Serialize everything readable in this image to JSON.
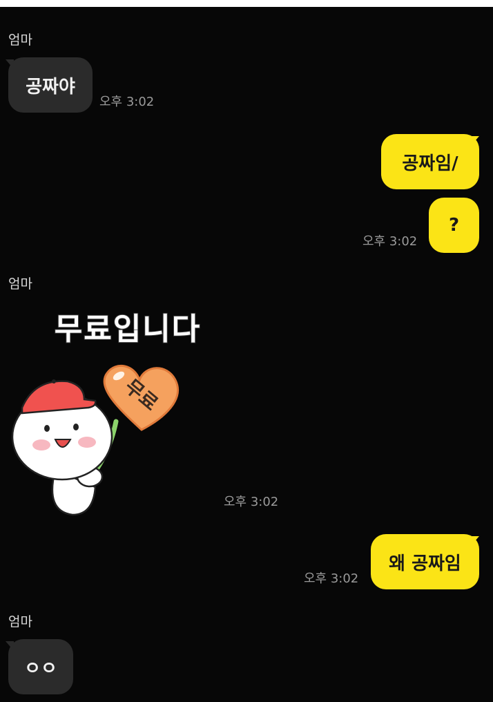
{
  "messages": [
    {
      "sender": "엄마",
      "text": "공짜야",
      "time": "오후 3:02"
    },
    {
      "text": "공짜임/"
    },
    {
      "text": "?",
      "time": "오후 3:02"
    },
    {
      "sender": "엄마",
      "sticker_text": "무료입니다",
      "sticker_heart_text": "무료",
      "time": "오후 3:02"
    },
    {
      "text": "왜 공짜임",
      "time": "오후 3:02"
    },
    {
      "sender": "엄마",
      "text": "ㅇㅇ"
    }
  ],
  "colors": {
    "background": "#070707",
    "incoming_bubble": "#2b2b2b",
    "outgoing_bubble": "#fbe416",
    "timestamp": "#9a9a9a"
  },
  "sticker": {
    "icon": "smiling-character-holding-heart-balloon"
  }
}
